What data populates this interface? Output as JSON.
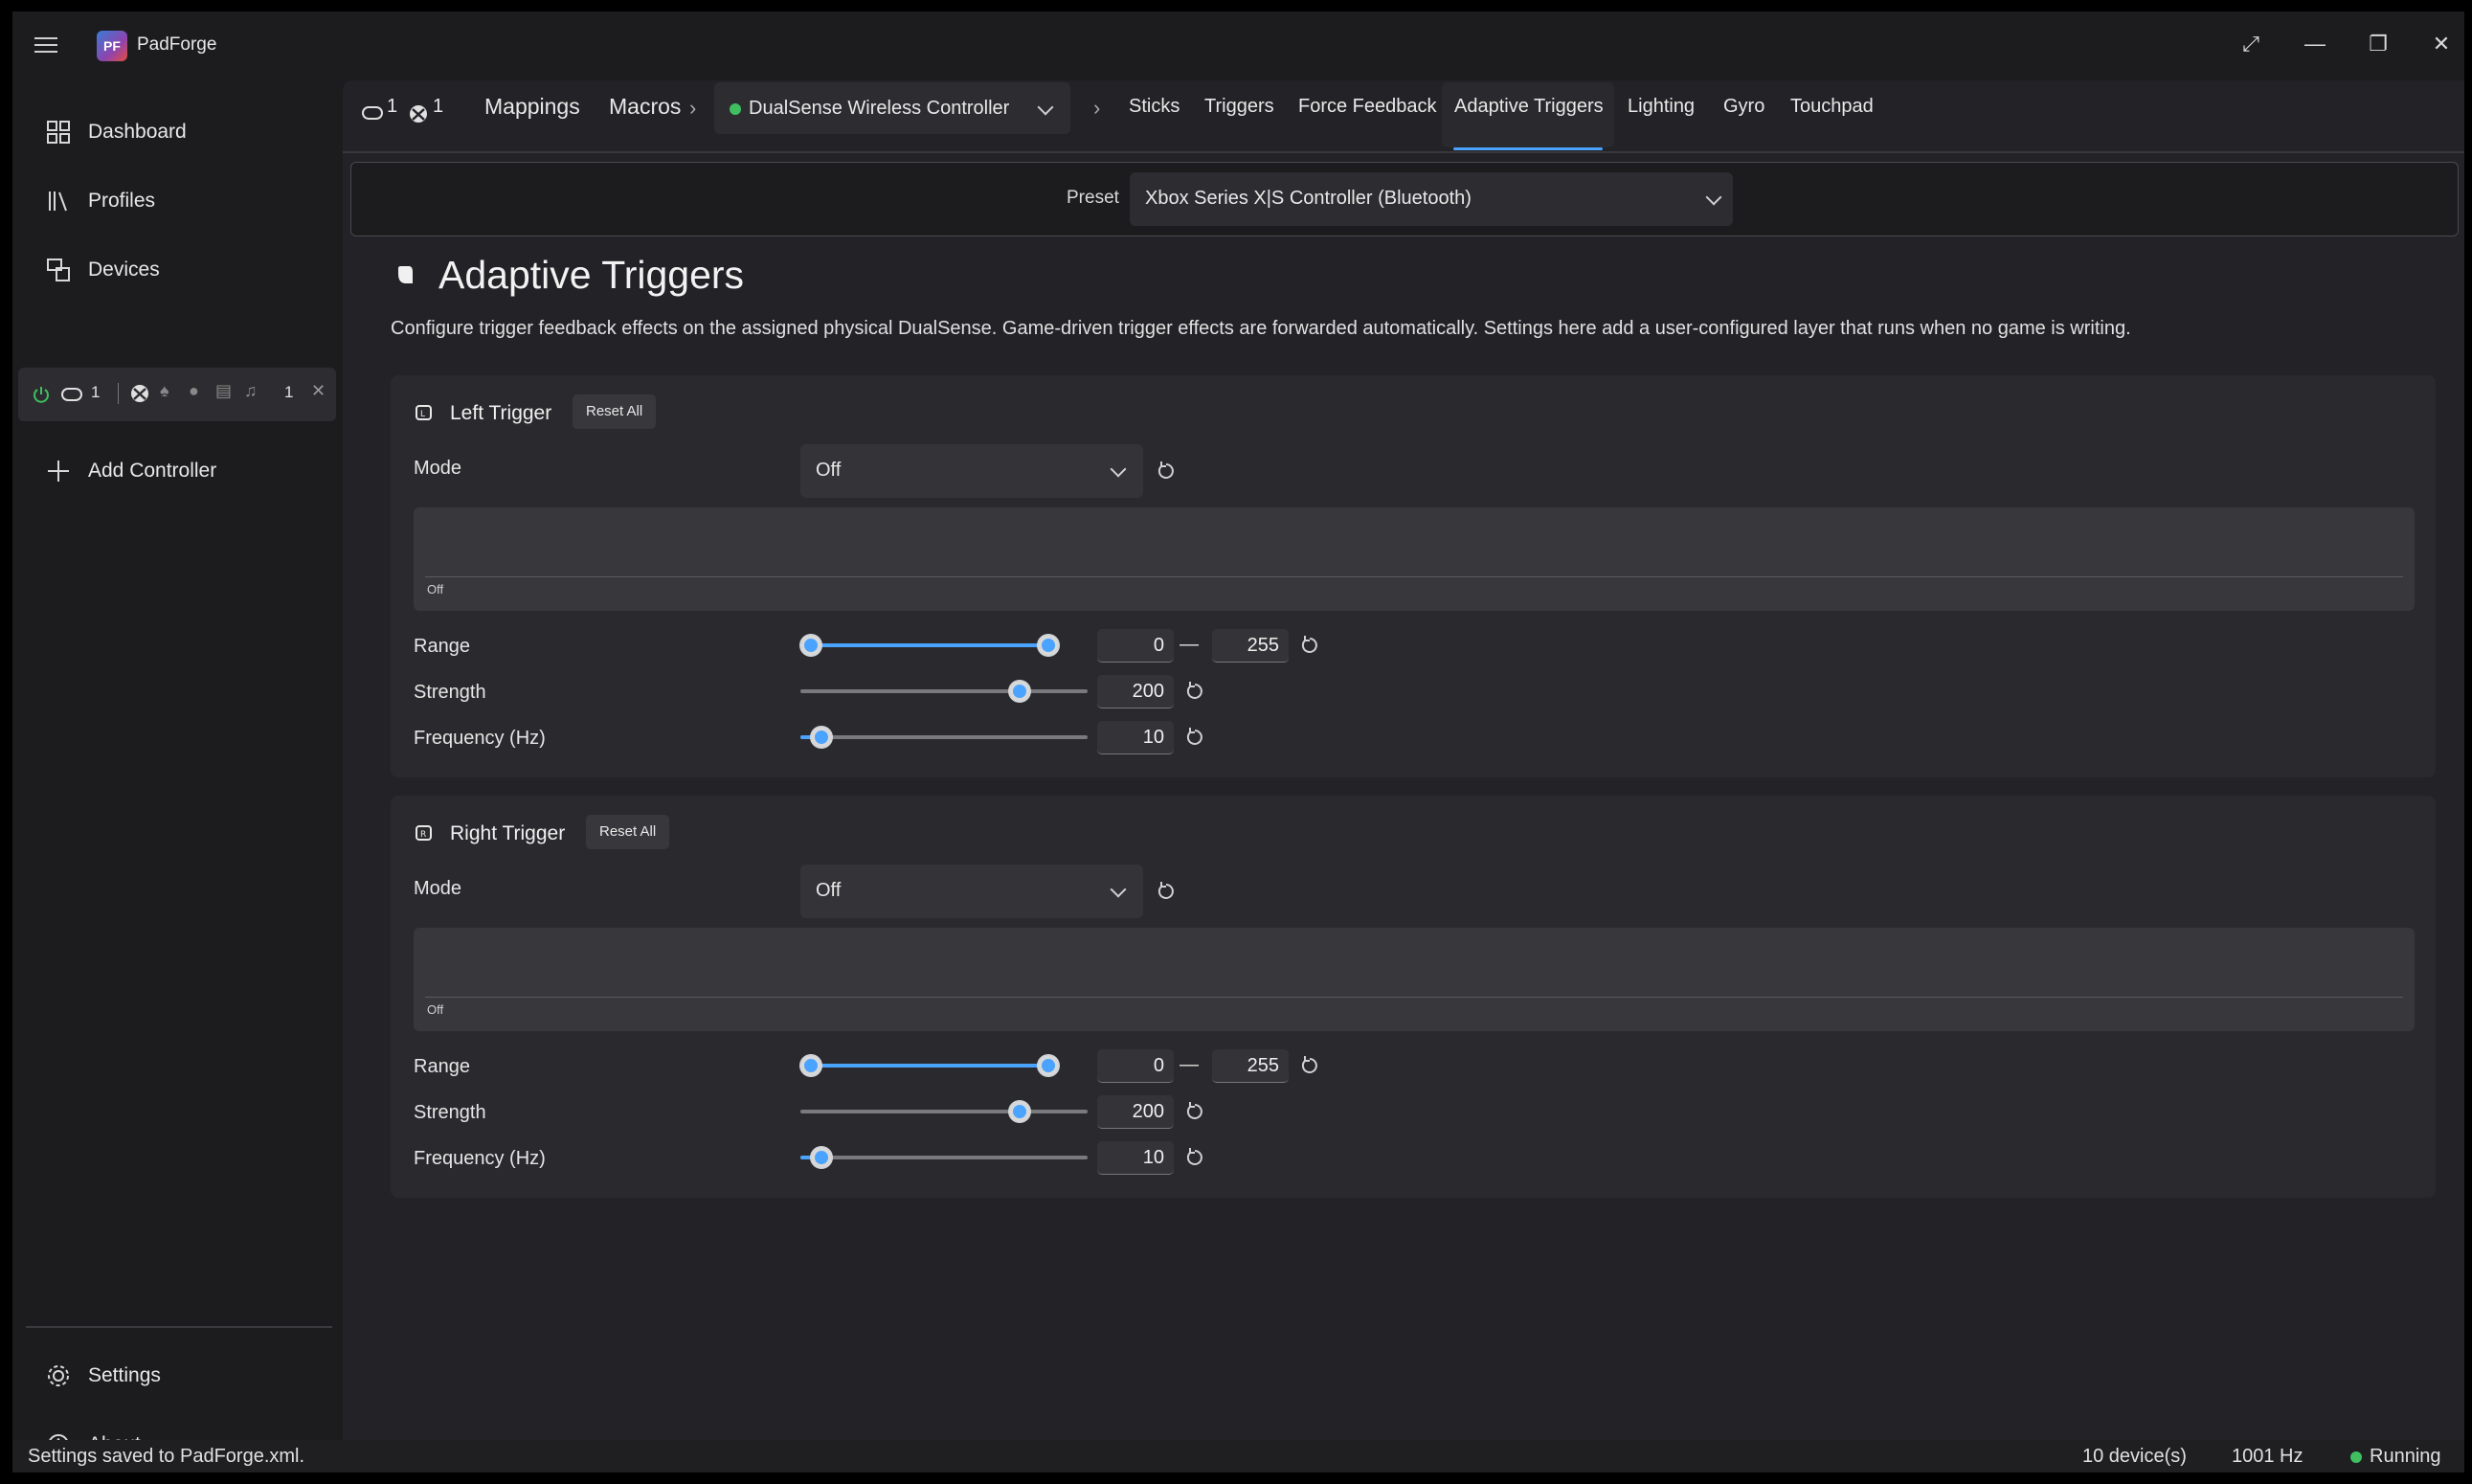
{
  "app": {
    "title": "PadForge",
    "logo_text": "PF"
  },
  "window_controls": {
    "expand": "⤢",
    "minimize": "—",
    "restore": "❐",
    "close": "✕"
  },
  "sidebar": {
    "items": [
      {
        "label": "Dashboard",
        "icon": "dashboard-icon"
      },
      {
        "label": "Profiles",
        "icon": "profiles-icon"
      },
      {
        "label": "Devices",
        "icon": "devices-icon"
      },
      {
        "label": "Add Controller",
        "icon": "plus-icon"
      }
    ],
    "device_pill": {
      "left_count": "1",
      "right_count": "1"
    },
    "bottom": [
      {
        "label": "Settings",
        "icon": "gear-icon"
      },
      {
        "label": "About",
        "icon": "info-icon"
      }
    ]
  },
  "tabs": {
    "counter_gamepad": "1",
    "counter_xbox": "1",
    "mappings": "Mappings",
    "macros": "Macros",
    "controller": "DualSense Wireless Controller",
    "controller_status_color": "#3fbf5f",
    "sub": [
      "Sticks",
      "Triggers",
      "Force Feedback",
      "Adaptive Triggers",
      "Lighting",
      "Gyro",
      "Touchpad"
    ],
    "active": "Adaptive Triggers"
  },
  "preset": {
    "label": "Preset",
    "value": "Xbox Series X|S Controller (Bluetooth)"
  },
  "page": {
    "title": "Adaptive Triggers",
    "description": "Configure trigger feedback effects on the assigned physical DualSense. Game-driven trigger effects are forwarded automatically. Settings here add a user-configured layer that runs when no game is writing."
  },
  "triggers": [
    {
      "name": "Left Trigger",
      "reset_label": "Reset All",
      "mode_label": "Mode",
      "mode_value": "Off",
      "preview_caption": "Off",
      "range_label": "Range",
      "range_min": 0,
      "range_max": 255,
      "range_min_text": "0",
      "range_max_text": "255",
      "strength_label": "Strength",
      "strength": 200,
      "strength_text": "200",
      "frequency_label": "Frequency (Hz)",
      "frequency": 10,
      "frequency_text": "10"
    },
    {
      "name": "Right Trigger",
      "reset_label": "Reset All",
      "mode_label": "Mode",
      "mode_value": "Off",
      "preview_caption": "Off",
      "range_label": "Range",
      "range_min": 0,
      "range_max": 255,
      "range_min_text": "0",
      "range_max_text": "255",
      "strength_label": "Strength",
      "strength": 200,
      "strength_text": "200",
      "frequency_label": "Frequency (Hz)",
      "frequency": 10,
      "frequency_text": "10"
    }
  ],
  "range_separator": "—",
  "status": {
    "message": "Settings saved to PadForge.xml.",
    "devices": "10 device(s)",
    "rate": "1001 Hz",
    "state": "Running",
    "state_color": "#3fbf5f"
  },
  "colors": {
    "accent": "#4aa3ff",
    "background": "#1c1c1f",
    "card": "#2a2a2e"
  }
}
